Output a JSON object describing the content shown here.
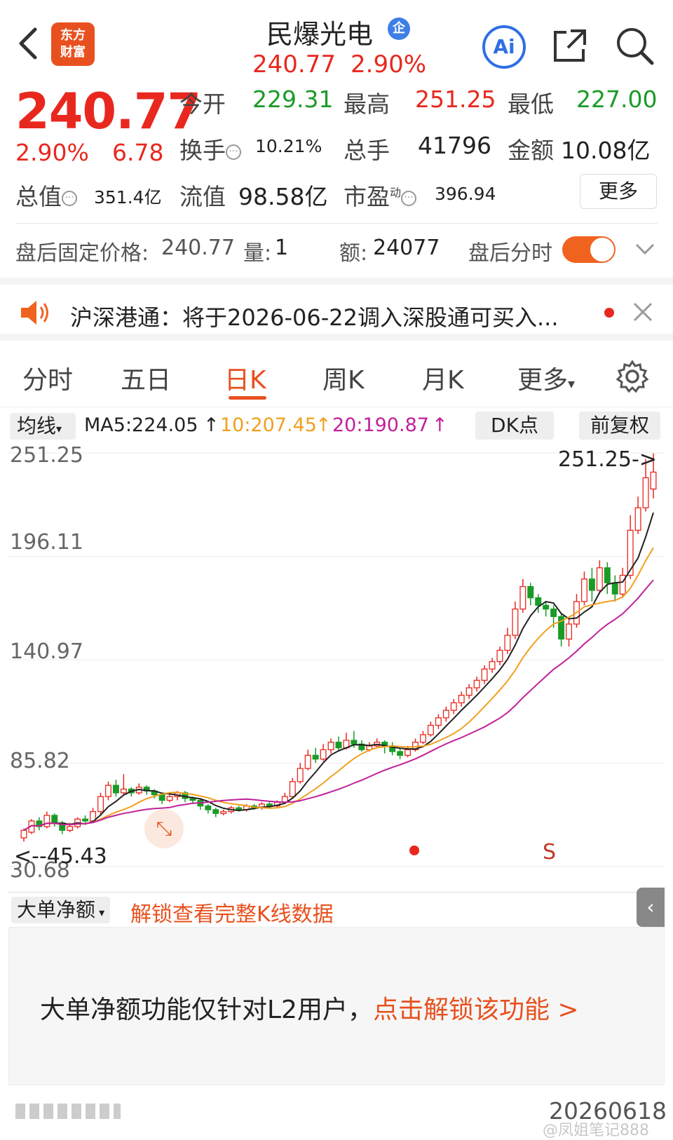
{
  "header": {
    "logo_line1": "东方",
    "logo_line2": "财富",
    "title": "民爆光电",
    "badge": "企",
    "price": "240.77",
    "change_pct": "2.90%",
    "ai_label": "Ai"
  },
  "quote": {
    "price": "240.77",
    "change_pct": "2.90%",
    "change_amt": "6.78",
    "open_label": "今开",
    "open": "229.31",
    "high_label": "最高",
    "high": "251.25",
    "low_label": "最低",
    "low": "227.00",
    "turnover_label": "换手",
    "turnover": "10.21%",
    "volume_label": "总手",
    "volume": "41796",
    "amount_label": "金额",
    "amount": "10.08亿",
    "mktcap_label": "总值",
    "mktcap": "351.4亿",
    "float_label": "流值",
    "float": "98.58亿",
    "pe_label": "市盈",
    "pe_sup": "动",
    "pe": "396.94",
    "more_label": "更多"
  },
  "after_hours": {
    "price_label": "盘后固定价格:",
    "price": "240.77",
    "vol_label": "量:",
    "vol": "1",
    "amt_label": "额:",
    "amt": "24077",
    "toggle_label": "盘后分时"
  },
  "notice": {
    "text": "沪深港通：将于2026-06-22调入深股通可买入..."
  },
  "tabs": [
    "分时",
    "五日",
    "日K",
    "周K",
    "月K",
    "更多"
  ],
  "active_tab": "日K",
  "ma_bar": {
    "dropdown": "均线",
    "ma5": "MA5:224.05",
    "ma10": "10:207.45",
    "ma20": "20:190.87",
    "dk_label": "DK点",
    "adjust_label": "前复权"
  },
  "chart_data": {
    "type": "candlestick",
    "y_ticks": [
      "251.25",
      "196.11",
      "140.97",
      "85.82",
      "30.68"
    ],
    "ylim": [
      30.68,
      251.25
    ],
    "high_marker": "251.25->",
    "low_marker": "<--45.43",
    "signal_marker": "S",
    "candles": [
      [
        46,
        50,
        44,
        51
      ],
      [
        49,
        55,
        48,
        56
      ],
      [
        55,
        52,
        50,
        57
      ],
      [
        52,
        58,
        51,
        60
      ],
      [
        58,
        54,
        52,
        59
      ],
      [
        54,
        50,
        48,
        55
      ],
      [
        50,
        52,
        49,
        54
      ],
      [
        52,
        56,
        51,
        57
      ],
      [
        56,
        55,
        53,
        58
      ],
      [
        55,
        60,
        54,
        62
      ],
      [
        60,
        68,
        58,
        70
      ],
      [
        68,
        74,
        66,
        76
      ],
      [
        74,
        70,
        68,
        77
      ],
      [
        70,
        72,
        69,
        80
      ],
      [
        72,
        70,
        68,
        73
      ],
      [
        70,
        73,
        69,
        75
      ],
      [
        73,
        71,
        69,
        74
      ],
      [
        71,
        69,
        67,
        72
      ],
      [
        69,
        66,
        64,
        70
      ],
      [
        66,
        68,
        65,
        69
      ],
      [
        68,
        70,
        66,
        71
      ],
      [
        70,
        67,
        65,
        71
      ],
      [
        67,
        66,
        64,
        68
      ],
      [
        66,
        63,
        61,
        67
      ],
      [
        63,
        61,
        59,
        64
      ],
      [
        61,
        59,
        57,
        62
      ],
      [
        59,
        60,
        58,
        61
      ],
      [
        60,
        62,
        59,
        63
      ],
      [
        62,
        61,
        60,
        63
      ],
      [
        61,
        63,
        60,
        64
      ],
      [
        63,
        62,
        61,
        64
      ],
      [
        62,
        64,
        61,
        65
      ],
      [
        64,
        63,
        62,
        65
      ],
      [
        63,
        65,
        62,
        66
      ],
      [
        65,
        68,
        64,
        70
      ],
      [
        68,
        76,
        67,
        78
      ],
      [
        76,
        83,
        75,
        86
      ],
      [
        83,
        90,
        82,
        93
      ],
      [
        90,
        88,
        86,
        94
      ],
      [
        88,
        93,
        87,
        96
      ],
      [
        93,
        97,
        91,
        99
      ],
      [
        97,
        94,
        92,
        100
      ],
      [
        94,
        98,
        93,
        102
      ],
      [
        98,
        96,
        94,
        103
      ],
      [
        96,
        93,
        92,
        98
      ],
      [
        93,
        95,
        92,
        97
      ],
      [
        95,
        97,
        94,
        99
      ],
      [
        97,
        95,
        91,
        98
      ],
      [
        95,
        92,
        90,
        97
      ],
      [
        92,
        90,
        88,
        94
      ],
      [
        90,
        93,
        89,
        95
      ],
      [
        93,
        97,
        92,
        99
      ],
      [
        97,
        101,
        96,
        103
      ],
      [
        101,
        106,
        100,
        108
      ],
      [
        106,
        110,
        104,
        112
      ],
      [
        110,
        114,
        108,
        116
      ],
      [
        114,
        118,
        112,
        120
      ],
      [
        118,
        122,
        116,
        124
      ],
      [
        122,
        126,
        120,
        128
      ],
      [
        126,
        130,
        124,
        132
      ],
      [
        130,
        136,
        128,
        138
      ],
      [
        136,
        140,
        134,
        142
      ],
      [
        140,
        146,
        138,
        148
      ],
      [
        146,
        154,
        144,
        158
      ],
      [
        154,
        168,
        152,
        172
      ],
      [
        168,
        180,
        166,
        184
      ],
      [
        180,
        174,
        170,
        182
      ],
      [
        174,
        170,
        166,
        176
      ],
      [
        170,
        168,
        164,
        172
      ],
      [
        168,
        164,
        158,
        170
      ],
      [
        164,
        152,
        148,
        166
      ],
      [
        152,
        160,
        148,
        164
      ],
      [
        160,
        172,
        158,
        176
      ],
      [
        172,
        184,
        170,
        188
      ],
      [
        184,
        178,
        172,
        190
      ],
      [
        178,
        190,
        176,
        194
      ],
      [
        190,
        182,
        176,
        193
      ],
      [
        182,
        176,
        172,
        186
      ],
      [
        176,
        186,
        174,
        190
      ],
      [
        186,
        210,
        184,
        218
      ],
      [
        210,
        222,
        208,
        228
      ],
      [
        222,
        238,
        220,
        248
      ],
      [
        232,
        241,
        227,
        251
      ]
    ]
  },
  "sub_panel": {
    "dropdown": "大单净额",
    "unlock_link": "解锁查看完整K线数据",
    "message": "大单净额功能仅针对L2用户，",
    "cta": "点击解锁该功能 >",
    "side_tab": "‹"
  },
  "footer": {
    "date": "20260618",
    "watermark": "@凤姐笔记888"
  },
  "colors": {
    "up": "#e8281f",
    "down": "#1a9b27",
    "accent": "#e8511f",
    "ma5": "#222222",
    "ma10": "#f0a020",
    "ma20": "#c0209a"
  }
}
